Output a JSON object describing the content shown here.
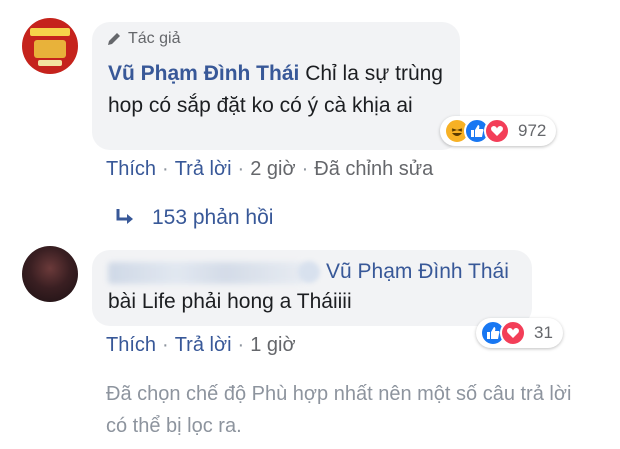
{
  "comment1": {
    "author_badge": "Tác giả",
    "author": "Vũ Phạm Đình Thái",
    "text": "Chỉ la sự trùng hop có sắp đặt ko có ý cà khịa ai",
    "reaction_count": "972",
    "reactions": [
      "haha-icon",
      "like-icon",
      "love-icon"
    ],
    "actions": {
      "like": "Thích",
      "reply": "Trả lời",
      "time": "2 giờ",
      "edited": "Đã chỉnh sửa"
    }
  },
  "replies_link": "153 phản hồi",
  "comment2": {
    "tagged_name": "Vũ Phạm Đình Thái",
    "text": "bài Life phải hong a Tháiiii",
    "reaction_count": "31",
    "reactions": [
      "like-icon",
      "love-icon"
    ],
    "actions": {
      "like": "Thích",
      "reply": "Trả lời",
      "time": "1 giờ"
    }
  },
  "filter_note": "Đã chọn chế độ Phù hợp nhất nên một số câu trả lời có thể bị lọc ra.",
  "colors": {
    "link": "#385898",
    "meta": "#65676b",
    "bubble": "#f2f3f5",
    "like": "#1877f2",
    "love": "#f33e58",
    "haha": "#f7b125"
  }
}
